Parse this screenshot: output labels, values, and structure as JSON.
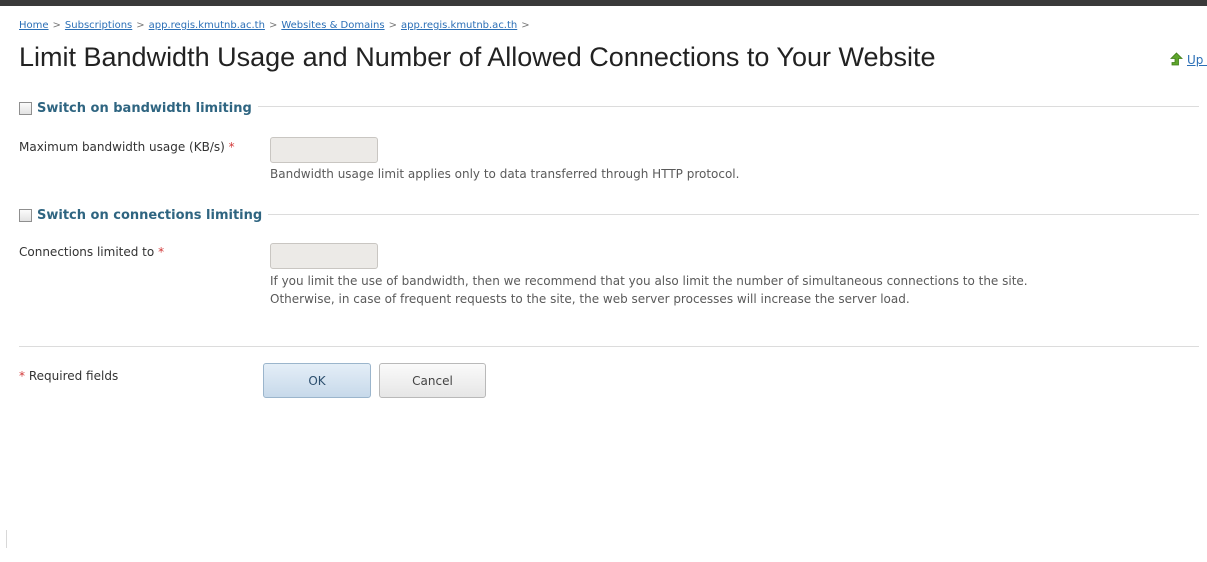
{
  "breadcrumb": {
    "items": [
      "Home",
      "Subscriptions",
      "app.regis.kmutnb.ac.th",
      "Websites & Domains",
      "app.regis.kmutnb.ac.th"
    ],
    "separator": ">"
  },
  "header": {
    "title": "Limit Bandwidth Usage and Number of Allowed Connections to Your Website",
    "up_level_label": "Up Level"
  },
  "bandwidth": {
    "toggle_label": "Switch on bandwidth limiting",
    "field_label": "Maximum bandwidth usage (KB/s)",
    "required_mark": "*",
    "value": "",
    "hint": "Bandwidth usage limit applies only to data transferred through HTTP protocol."
  },
  "connections": {
    "toggle_label": "Switch on connections limiting",
    "field_label": "Connections limited to",
    "required_mark": "*",
    "value": "",
    "hint_line1": "If you limit the use of bandwidth, then we recommend that you also limit the number of simultaneous connections to the site.",
    "hint_line2": "Otherwise, in case of frequent requests to the site, the web server processes will increase the server load."
  },
  "footer": {
    "required_mark": "*",
    "required_note": "Required fields",
    "ok_label": "OK",
    "cancel_label": "Cancel"
  },
  "colors": {
    "link": "#2b6fb6",
    "section_heading": "#2f6581",
    "required": "#d23a3a",
    "up_arrow": "#5ea52c"
  },
  "icons": {
    "up_level": "up-arrow-icon"
  }
}
